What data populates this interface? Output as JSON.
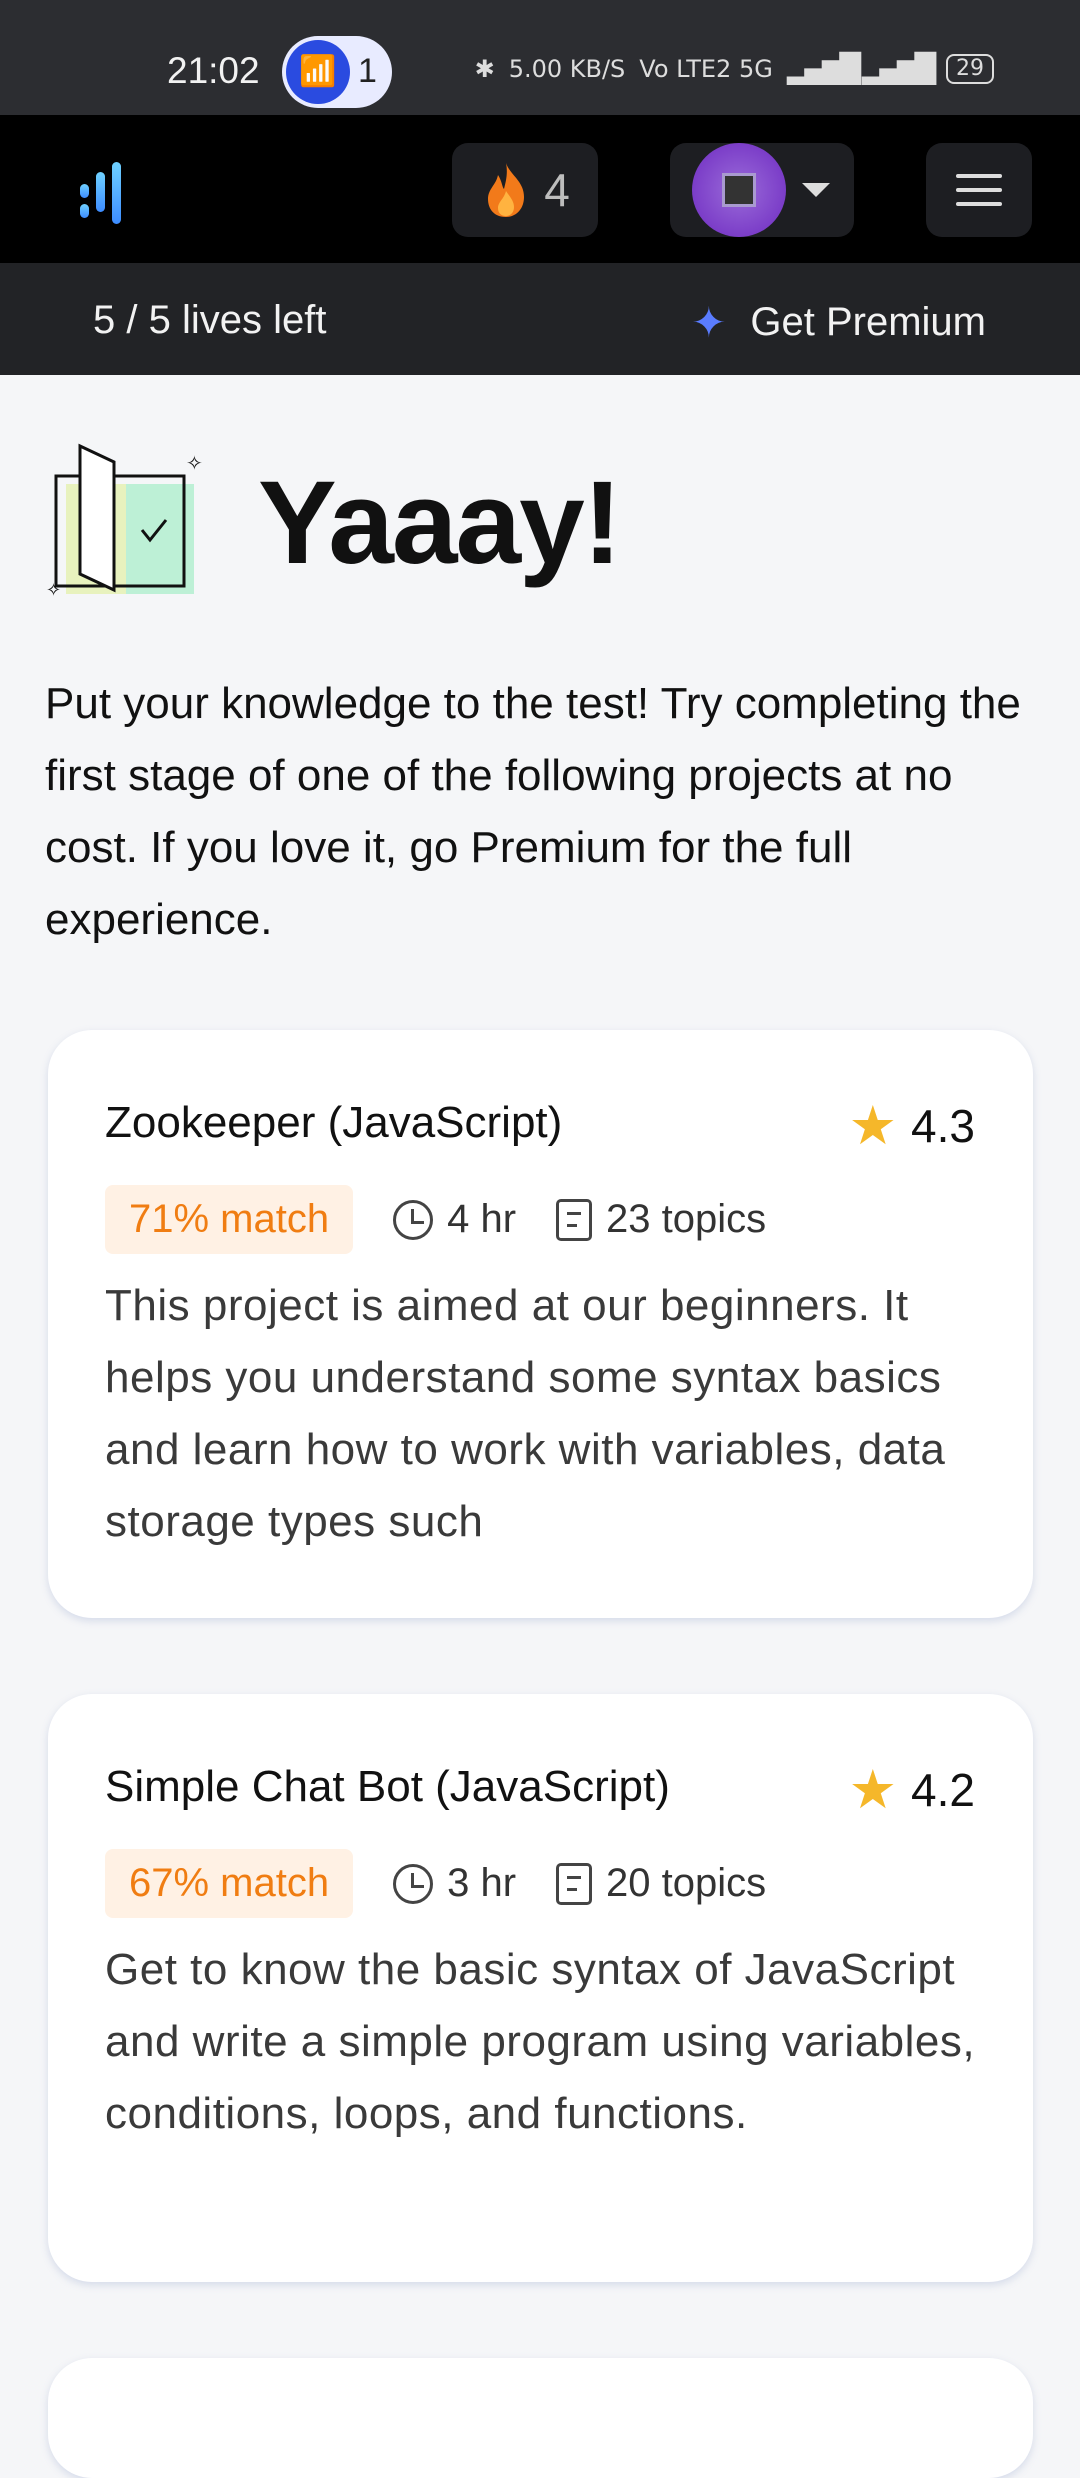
{
  "status": {
    "time": "21:02",
    "notif_count": "1",
    "speed": "5.00 KB/S",
    "network": "Vo LTE2 5G",
    "battery": "29"
  },
  "nav": {
    "streak_count": "4"
  },
  "lives": {
    "text": "5 / 5 lives left",
    "premium_label": "Get Premium"
  },
  "hero": {
    "title": "Yaaay!",
    "intro": "Put your knowledge to the test! Try completing the first stage of one of the following projects at no cost. If you love it, go Premium for the full experience."
  },
  "projects": [
    {
      "title": "Zookeeper (JavaScript)",
      "rating": "4.3",
      "match": "71% match",
      "duration": "4 hr",
      "topics": "23 topics",
      "description": "This project is aimed at our beginners. It helps you understand some syntax basics and learn how to work with variables, data storage types such"
    },
    {
      "title": "Simple Chat Bot (JavaScript)",
      "rating": "4.2",
      "match": "67% match",
      "duration": "3 hr",
      "topics": "20 topics",
      "description": "Get to know the basic syntax of JavaScript and write a simple program using variables, conditions, loops, and functions."
    }
  ],
  "colors": {
    "accent": "#f07d12",
    "match_bg": "#fff1e4",
    "star": "#f5b72a",
    "premium_sparkle": "#5a7cff"
  }
}
